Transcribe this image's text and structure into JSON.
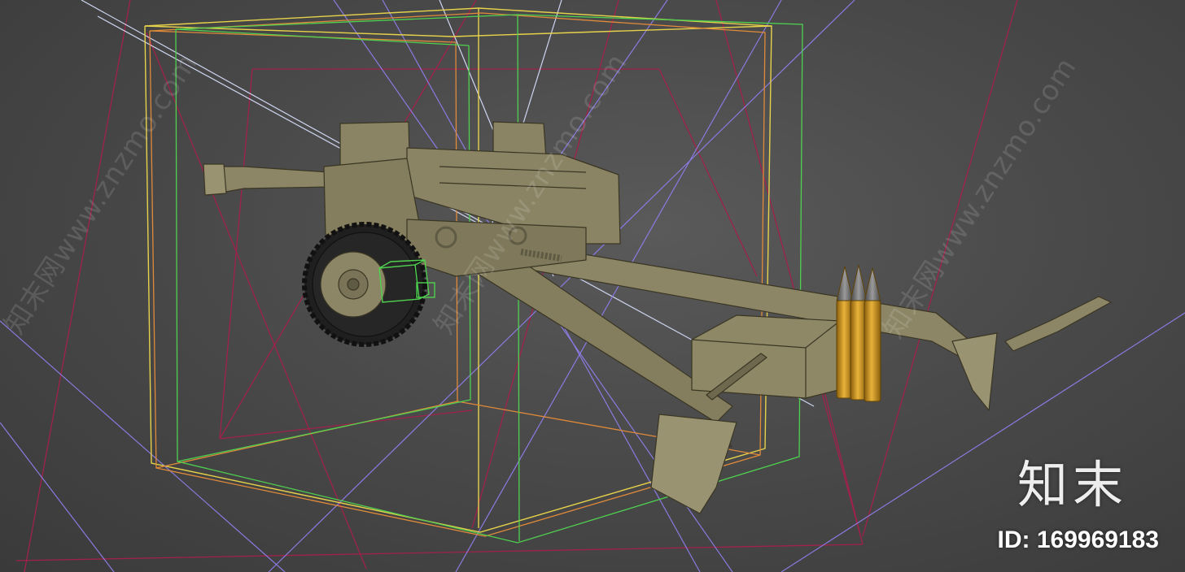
{
  "watermark": {
    "diagonal_text": "知末网www.znzmo.com",
    "brand": "知末",
    "id_text": "ID: 169969183"
  },
  "scene": {
    "object": "howitzer-model",
    "colors": {
      "background": "#4a4a4a",
      "model_body": "#8c8566",
      "model_shadow": "#3a3624",
      "tire": "#222222",
      "shell_brass": "#d6a020",
      "shell_tip": "#777777",
      "bbox_yellow": "#e6d24a",
      "bbox_green": "#4fd14f",
      "bbox_orange": "#e08a3a",
      "frustum_red": "#a0224a",
      "light_ray_blue": "#8a7ae0",
      "light_ray_white": "#cfd6f2"
    }
  }
}
